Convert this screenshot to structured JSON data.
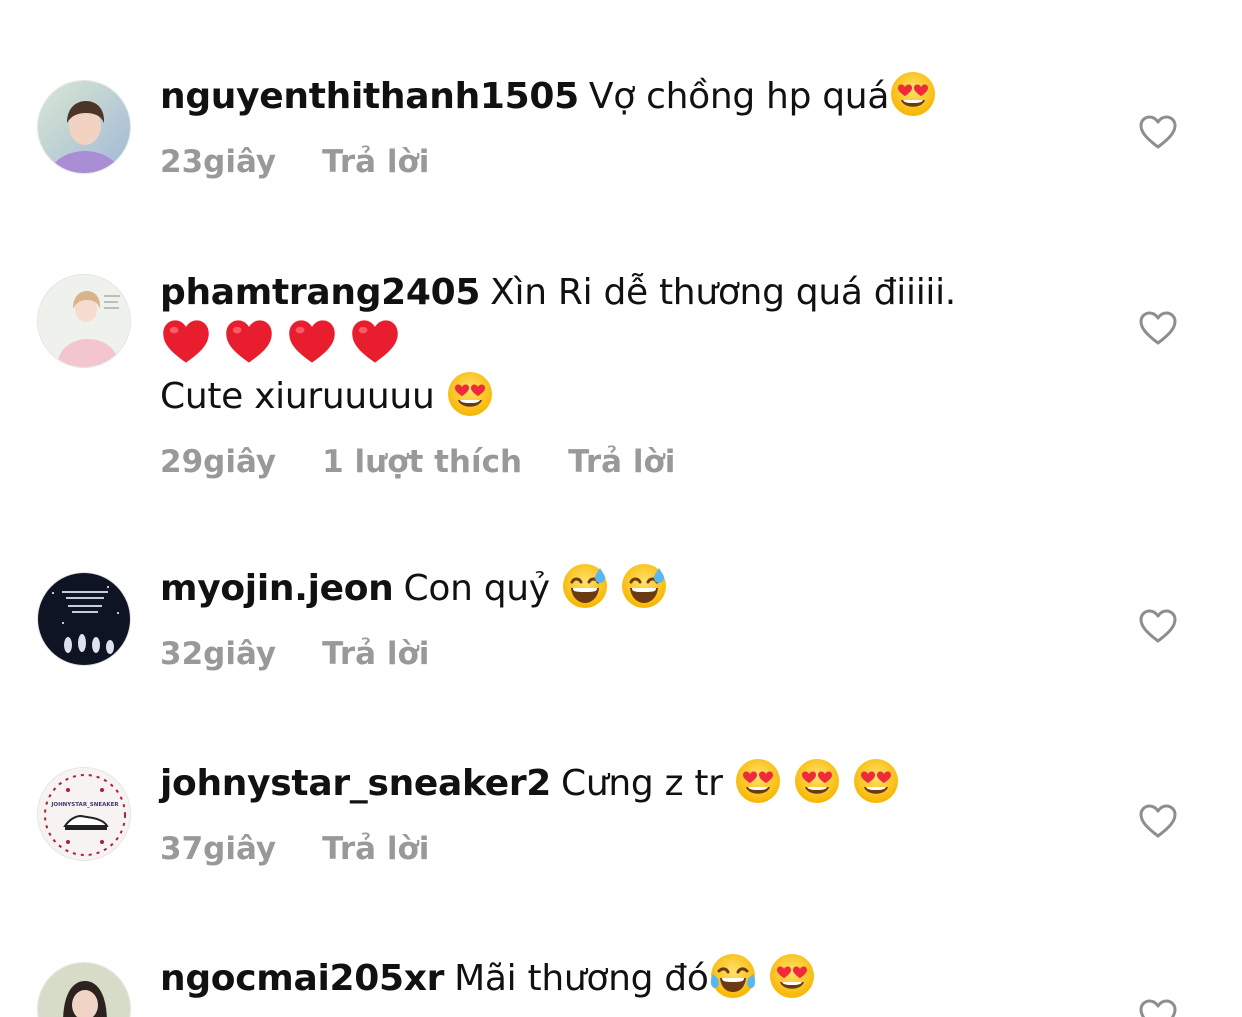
{
  "comments": [
    {
      "username": "nguyenthithanh1505",
      "text": "Vợ chồng hp quá",
      "emoji": [
        "heart-eyes"
      ],
      "time": "23giây",
      "reply": "Trả lời"
    },
    {
      "username": "phamtrang2405",
      "text": "Xìn Ri dễ thương quá điiiii.",
      "line2_emoji": [
        "red-heart",
        "red-heart",
        "red-heart",
        "red-heart"
      ],
      "line3_text": "Cute xiuruuuuu",
      "line3_emoji": [
        "heart-eyes"
      ],
      "time": "29giây",
      "likes": "1 lượt thích",
      "reply": "Trả lời"
    },
    {
      "username": "myojin.jeon",
      "text": "Con quỷ",
      "emoji": [
        "sweat-smile",
        "sweat-smile"
      ],
      "time": "32giây",
      "reply": "Trả lời"
    },
    {
      "username": "johnystar_sneaker2",
      "text": "Cưng z tr",
      "emoji": [
        "heart-eyes",
        "heart-eyes",
        "heart-eyes"
      ],
      "time": "37giây",
      "reply": "Trả lời",
      "avatar_text": "JOHNYSTAR_SNEAKER"
    },
    {
      "username": "ngocmai205xr",
      "text": "Mãi thương đó",
      "emoji": [
        "tears-of-joy",
        "heart-eyes"
      ]
    }
  ],
  "colors": {
    "text": "#111111",
    "meta": "#999999",
    "heart_outline": "#8e8e8e"
  },
  "icons": [
    "heart-outline-icon",
    "heart-eyes-emoji",
    "red-heart-emoji",
    "sweat-smile-emoji",
    "tears-of-joy-emoji"
  ]
}
